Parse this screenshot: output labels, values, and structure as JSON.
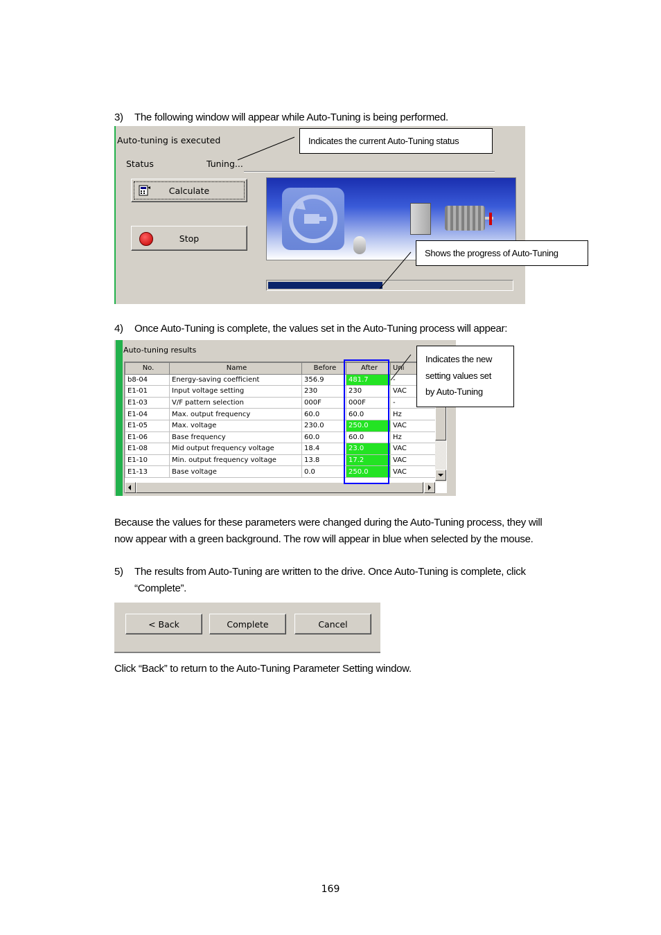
{
  "step3": {
    "num": "3)",
    "text": "The following window will appear while Auto-Tuning is being performed.",
    "window": {
      "title": "Auto-tuning is executed",
      "status_label": "Status",
      "status_value": "Tuning...",
      "calculate_label": "Calculate",
      "stop_label": "Stop",
      "progress": 0.47
    },
    "callout_status": "Indicates the current Auto-Tuning status",
    "callout_progress": "Shows the progress of Auto-Tuning"
  },
  "step4": {
    "num": "4)",
    "text": "Once Auto-Tuning is complete, the values set in the Auto-Tuning process will appear:",
    "window": {
      "title": "Auto-tuning results",
      "columns": [
        "No.",
        "Name",
        "Before",
        "After",
        "Uni"
      ],
      "rows": [
        {
          "no": "b8-04",
          "name": "Energy-saving coefficient",
          "before": "356.9",
          "after": "481.7",
          "unit": "-",
          "changed": true
        },
        {
          "no": "E1-01",
          "name": "Input voltage setting",
          "before": "230",
          "after": "230",
          "unit": "VAC",
          "changed": false
        },
        {
          "no": "E1-03",
          "name": "V/F pattern selection",
          "before": "000F",
          "after": "000F",
          "unit": "-",
          "changed": false
        },
        {
          "no": "E1-04",
          "name": "Max. output frequency",
          "before": "60.0",
          "after": "60.0",
          "unit": "Hz",
          "changed": false
        },
        {
          "no": "E1-05",
          "name": "Max. voltage",
          "before": "230.0",
          "after": "250.0",
          "unit": "VAC",
          "changed": true
        },
        {
          "no": "E1-06",
          "name": "Base frequency",
          "before": "60.0",
          "after": "60.0",
          "unit": "Hz",
          "changed": false
        },
        {
          "no": "E1-08",
          "name": "Mid output frequency voltage",
          "before": "18.4",
          "after": "23.0",
          "unit": "VAC",
          "changed": true
        },
        {
          "no": "E1-10",
          "name": "Min. output frequency voltage",
          "before": "13.8",
          "after": "17.2",
          "unit": "VAC",
          "changed": true
        },
        {
          "no": "E1-13",
          "name": "Base voltage",
          "before": "0.0",
          "after": "250.0",
          "unit": "VAC",
          "changed": true
        }
      ]
    },
    "callout_lines": [
      "Indicates the new",
      "setting values set",
      "by Auto-Tuning"
    ]
  },
  "para_changed": [
    "Because the values for these parameters were changed during the Auto-Tuning process, they will",
    "now appear with a green background. The row will appear in blue when selected by the mouse."
  ],
  "step5": {
    "num": "5)",
    "lines": [
      "The results from Auto-Tuning are written to the drive. Once Auto-Tuning is complete, click",
      "“Complete”."
    ],
    "buttons": {
      "back": "< Back",
      "complete": "Complete",
      "cancel": "Cancel"
    }
  },
  "para_back": "Click “Back” to return to the Auto-Tuning Parameter Setting window.",
  "page_number": "169",
  "colors": {
    "changed_cell": "#23e323",
    "highlight_box": "#0000ff",
    "progress_fill": "#0a246a",
    "window_bg": "#d4d0c8"
  }
}
